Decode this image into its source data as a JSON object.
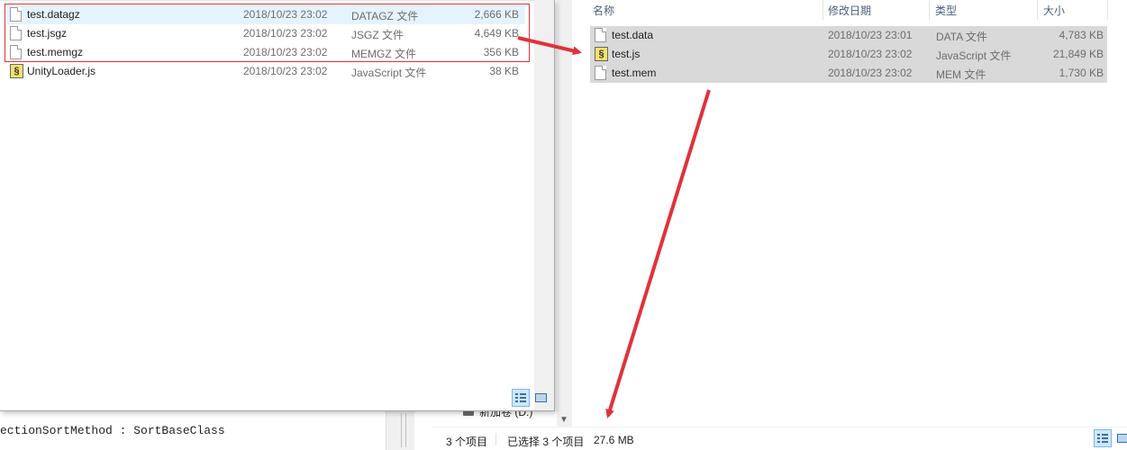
{
  "code_editor": {
    "visible_line": "ectionSortMethod : SortBaseClass"
  },
  "right_explorer": {
    "columns": {
      "name": "名称",
      "date": "修改日期",
      "type": "类型",
      "size": "大小"
    },
    "nav_drive_label": "新加卷 (D:)",
    "files": [
      {
        "name": "test.data",
        "date": "2018/10/23 23:01",
        "type": "DATA 文件",
        "size": "4,783 KB",
        "icon": "document-icon",
        "selected": true
      },
      {
        "name": "test.js",
        "date": "2018/10/23 23:02",
        "type": "JavaScript 文件",
        "size": "21,849 KB",
        "icon": "javascript-file-icon",
        "selected": true
      },
      {
        "name": "test.mem",
        "date": "2018/10/23 23:02",
        "type": "MEM 文件",
        "size": "1,730 KB",
        "icon": "document-icon",
        "selected": true
      }
    ],
    "status": {
      "count": "3 个项目",
      "selected": "已选择 3 个项目",
      "size": "27.6 MB"
    }
  },
  "left_explorer": {
    "files": [
      {
        "name": "test.datagz",
        "date": "2018/10/23 23:02",
        "type": "DATAGZ 文件",
        "size": "2,666 KB",
        "icon": "document-icon",
        "highlighted": true
      },
      {
        "name": "test.jsgz",
        "date": "2018/10/23 23:02",
        "type": "JSGZ 文件",
        "size": "4,649 KB",
        "icon": "document-icon",
        "highlighted": false
      },
      {
        "name": "test.memgz",
        "date": "2018/10/23 23:02",
        "type": "MEMGZ 文件",
        "size": "356 KB",
        "icon": "document-icon",
        "highlighted": false
      },
      {
        "name": "UnityLoader.js",
        "date": "2018/10/23 23:02",
        "type": "JavaScript 文件",
        "size": "38 KB",
        "icon": "javascript-file-icon",
        "highlighted": false
      }
    ]
  },
  "colors": {
    "annotation_red": "#e0323a",
    "selection_gray": "#d9d9d9",
    "hover_blue": "#e5f3ff",
    "header_text": "#4c607a"
  }
}
